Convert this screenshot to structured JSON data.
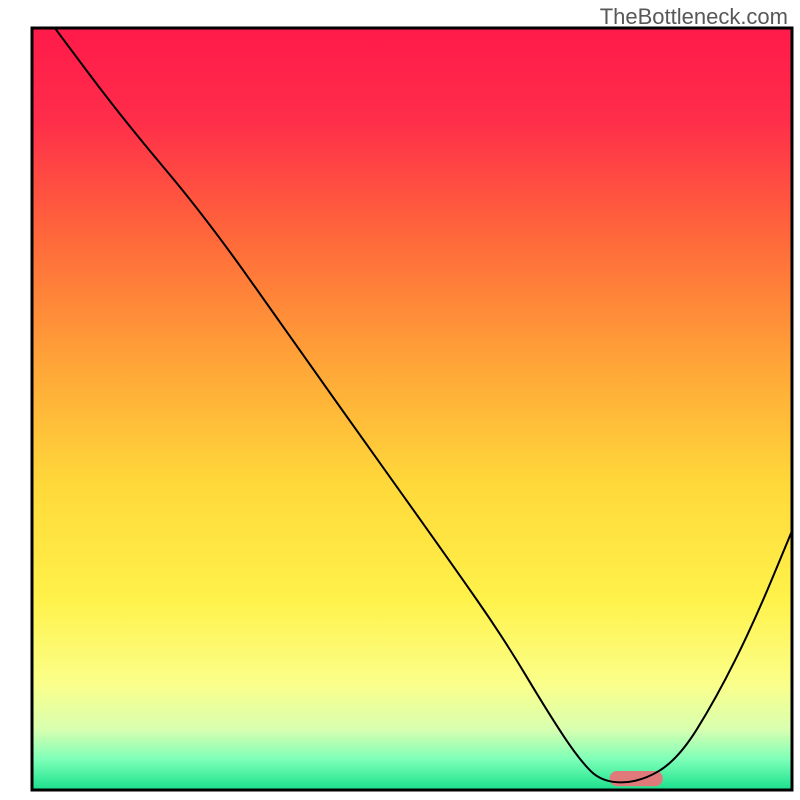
{
  "watermark": "TheBottleneck.com",
  "chart_data": {
    "type": "line",
    "title": "",
    "xlabel": "",
    "ylabel": "",
    "xlim": [
      0,
      100
    ],
    "ylim": [
      0,
      100
    ],
    "axes_visible": false,
    "background_gradient": {
      "stops": [
        {
          "offset": 0.0,
          "color": "#ff1a4a"
        },
        {
          "offset": 0.12,
          "color": "#ff2d4a"
        },
        {
          "offset": 0.28,
          "color": "#ff6a3a"
        },
        {
          "offset": 0.45,
          "color": "#ffa838"
        },
        {
          "offset": 0.6,
          "color": "#ffd93a"
        },
        {
          "offset": 0.75,
          "color": "#fff24a"
        },
        {
          "offset": 0.86,
          "color": "#fbff8a"
        },
        {
          "offset": 0.92,
          "color": "#d9ffb0"
        },
        {
          "offset": 0.96,
          "color": "#7dffb8"
        },
        {
          "offset": 1.0,
          "color": "#19e08c"
        }
      ]
    },
    "series": [
      {
        "name": "bottleneck-curve",
        "color": "#000000",
        "stroke_width": 2,
        "x": [
          3,
          12,
          23,
          35,
          45,
          55,
          62,
          68,
          72,
          75,
          80,
          85,
          90,
          95,
          100
        ],
        "y": [
          100,
          88,
          75,
          58,
          44,
          30,
          20,
          10,
          4,
          1,
          1,
          4,
          12,
          22,
          34
        ]
      }
    ],
    "marker": {
      "name": "highlight-bar",
      "shape": "rounded-rect",
      "color": "#e07a7a",
      "x": 76,
      "width": 7,
      "y": 0.5,
      "height": 2
    },
    "border": {
      "color": "#000000",
      "width": 3
    }
  }
}
